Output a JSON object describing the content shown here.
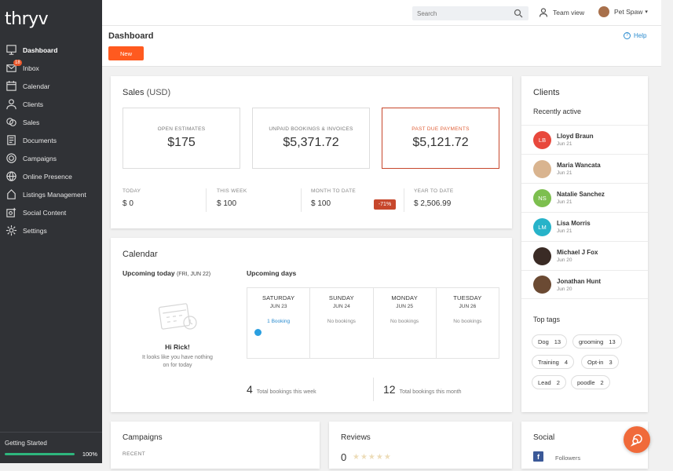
{
  "app": {
    "logo": "thryv"
  },
  "sidebar": {
    "items": [
      {
        "label": "Dashboard",
        "icon": "dashboard-icon",
        "active": true
      },
      {
        "label": "Inbox",
        "icon": "inbox-icon",
        "badge": "18"
      },
      {
        "label": "Calendar",
        "icon": "calendar-icon"
      },
      {
        "label": "Clients",
        "icon": "clients-icon"
      },
      {
        "label": "Sales",
        "icon": "sales-icon"
      },
      {
        "label": "Documents",
        "icon": "documents-icon"
      },
      {
        "label": "Campaigns",
        "icon": "campaigns-icon"
      },
      {
        "label": "Online Presence",
        "icon": "globe-icon"
      },
      {
        "label": "Listings Management",
        "icon": "listings-icon"
      },
      {
        "label": "Social Content",
        "icon": "social-content-icon"
      },
      {
        "label": "Settings",
        "icon": "gear-icon"
      }
    ],
    "getting_started": {
      "label": "Getting Started",
      "progress_text": "100%",
      "progress": 1.0
    }
  },
  "topbar": {
    "search_placeholder": "Search",
    "team_view": "Team view",
    "user_name": "Pet Spaw"
  },
  "header": {
    "title": "Dashboard",
    "new_button": "New",
    "help": "Help"
  },
  "sales": {
    "title": "Sales",
    "currency": "(USD)",
    "boxes": [
      {
        "label": "OPEN ESTIMATES",
        "value": "$175"
      },
      {
        "label": "UNPAID BOOKINGS & INVOICES",
        "value": "$5,371.72"
      },
      {
        "label": "PAST DUE PAYMENTS",
        "value": "$5,121.72"
      }
    ],
    "periods": [
      {
        "label": "TODAY",
        "value": "$ 0"
      },
      {
        "label": "THIS WEEK",
        "value": "$ 100"
      },
      {
        "label": "MONTH TO DATE",
        "value": "$ 100",
        "badge": "-71%"
      },
      {
        "label": "YEAR TO DATE",
        "value": "$ 2,506.99"
      }
    ]
  },
  "calendar": {
    "title": "Calendar",
    "upcoming_today": "Upcoming today",
    "today_date": "(FRI, JUN 22)",
    "greeting": "Hi Rick!",
    "greeting_sub": "It looks like you have nothing on for today",
    "upcoming_days": "Upcoming days",
    "days": [
      {
        "name": "SATURDAY",
        "date": "JUN 23",
        "bookings": "1 Booking",
        "has": true
      },
      {
        "name": "SUNDAY",
        "date": "JUN 24",
        "bookings": "No bookings",
        "has": false
      },
      {
        "name": "MONDAY",
        "date": "JUN 25",
        "bookings": "No bookings",
        "has": false
      },
      {
        "name": "TUESDAY",
        "date": "JUN 26",
        "bookings": "No bookings",
        "has": false
      }
    ],
    "week_total": "4",
    "week_label": "Total bookings this week",
    "month_total": "12",
    "month_label": "Total bookings this month"
  },
  "clients": {
    "title": "Clients",
    "recent_title": "Recently active",
    "list": [
      {
        "name": "Lloyd Braun",
        "date": "Jun 21",
        "initials": "LB",
        "color": "#e8483c",
        "photo": false
      },
      {
        "name": "Maria Wancata",
        "date": "Jun 21",
        "initials": "",
        "color": "#d9b48f",
        "photo": true
      },
      {
        "name": "Natalie Sanchez",
        "date": "Jun 21",
        "initials": "NS",
        "color": "#7dbf4f",
        "photo": false
      },
      {
        "name": "Lisa Morris",
        "date": "Jun 21",
        "initials": "LM",
        "color": "#27b3c9",
        "photo": false
      },
      {
        "name": "Michael J Fox",
        "date": "Jun 20",
        "initials": "",
        "color": "#3a2b25",
        "photo": true
      },
      {
        "name": "Jonathan Hunt",
        "date": "Jun 20",
        "initials": "",
        "color": "#6b4a33",
        "photo": true
      }
    ],
    "top_tags_title": "Top tags",
    "tags": [
      {
        "name": "Dog",
        "count": "13"
      },
      {
        "name": "grooming",
        "count": "13"
      },
      {
        "name": "Training",
        "count": "4"
      },
      {
        "name": "Opt-in",
        "count": "3"
      },
      {
        "name": "Lead",
        "count": "2"
      },
      {
        "name": "poodle",
        "count": "2"
      }
    ]
  },
  "campaigns": {
    "title": "Campaigns",
    "recent": "RECENT"
  },
  "reviews": {
    "title": "Reviews",
    "count": "0",
    "stars": "★★★★★"
  },
  "social": {
    "title": "Social",
    "followers": "Followers",
    "fb_glyph": "f"
  },
  "colors": {
    "accent": "#ff5a1f",
    "sidebar": "#303236",
    "alert": "#c7472c",
    "link": "#2a8bcf"
  }
}
